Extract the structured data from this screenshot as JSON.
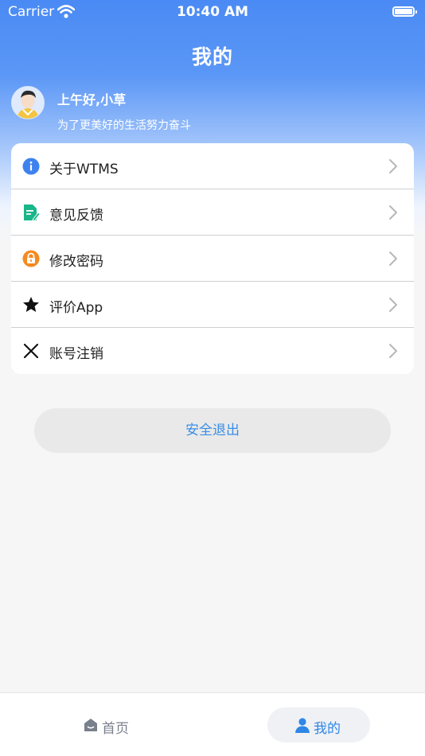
{
  "status_bar": {
    "carrier": "Carrier",
    "time": "10:40 AM"
  },
  "page": {
    "title": "我的"
  },
  "profile": {
    "greeting": "上午好,小草",
    "motto": "为了更美好的生活努力奋斗"
  },
  "menu": {
    "items": [
      {
        "label": "关于WTMS",
        "icon": "info-icon"
      },
      {
        "label": "意见反馈",
        "icon": "feedback-document-icon"
      },
      {
        "label": "修改密码",
        "icon": "lock-icon"
      },
      {
        "label": "评价App",
        "icon": "star-icon"
      },
      {
        "label": "账号注销",
        "icon": "close-x-icon"
      }
    ]
  },
  "logout": {
    "label": "安全退出"
  },
  "tabbar": {
    "tabs": [
      {
        "label": "首页",
        "icon": "home-icon",
        "active": false
      },
      {
        "label": "我的",
        "icon": "person-icon",
        "active": true
      }
    ]
  },
  "colors": {
    "header_blue": "#4a8af4",
    "accent_blue": "#2f86e6",
    "info_icon_blue": "#3d82ef",
    "feedback_icon_green": "#19b58b",
    "lock_icon_orange": "#f58a1f"
  }
}
